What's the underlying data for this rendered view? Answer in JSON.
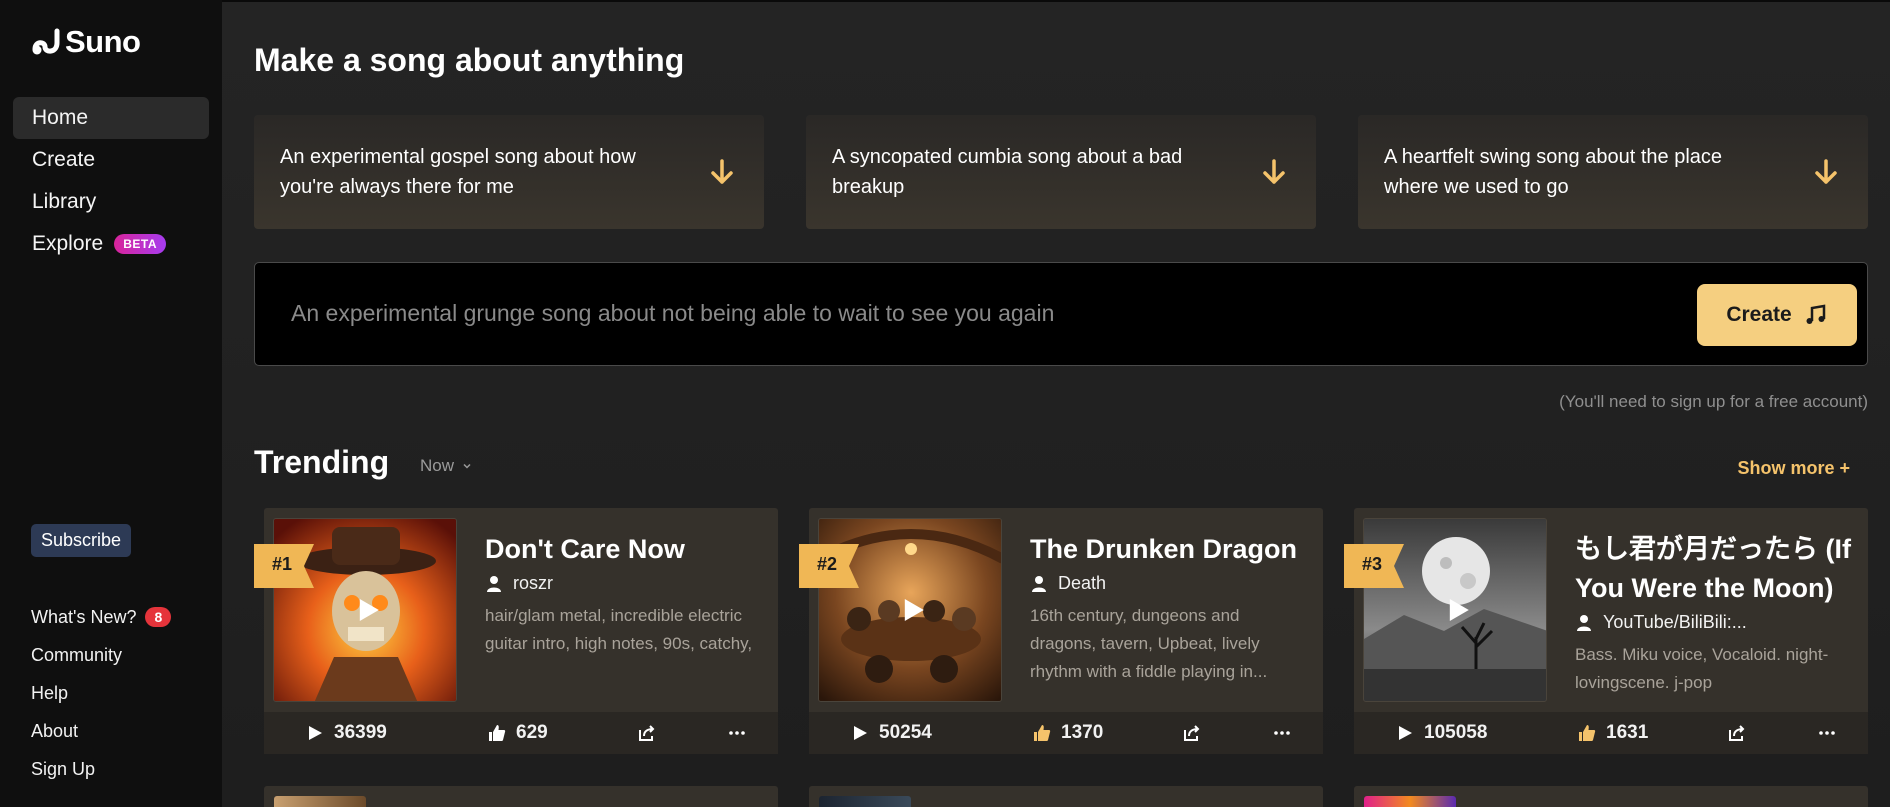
{
  "sidebar": {
    "logo_text": "Suno",
    "nav": [
      {
        "label": "Home"
      },
      {
        "label": "Create"
      },
      {
        "label": "Library"
      },
      {
        "label": "Explore",
        "badge": "BETA"
      }
    ],
    "subscribe_label": "Subscribe",
    "links": [
      {
        "label": "What's New?",
        "badge": "8"
      },
      {
        "label": "Community"
      },
      {
        "label": "Help"
      },
      {
        "label": "About"
      },
      {
        "label": "Sign Up"
      }
    ]
  },
  "main": {
    "headline": "Make a song about anything",
    "prompts": [
      {
        "text": "An experimental gospel song about how you're always there for me",
        "icon": "arrow-down-icon"
      },
      {
        "text": "A syncopated cumbia song about a bad breakup",
        "icon": "arrow-down-icon"
      },
      {
        "text": "A heartfelt swing song about the place where we used to go",
        "icon": "arrow-down-icon"
      }
    ],
    "input_placeholder": "An experimental grunge song about not being able to wait to see you again",
    "create_label": "Create",
    "signup_note": "(You'll need to sign up for a free account)",
    "trending_title": "Trending",
    "filter_label": "Now",
    "show_more_label": "Show more +"
  },
  "songs": [
    {
      "rank": "#1",
      "title": "Don't Care Now",
      "author": "roszr",
      "tags": "hair/glam metal, incredible electric guitar intro, high notes, 90s, catchy,",
      "plays": "36399",
      "likes": "629"
    },
    {
      "rank": "#2",
      "title": "The Drunken Dragon",
      "author": "Death",
      "tags": "16th century, dungeons and dragons, tavern, Upbeat, lively rhythm with a fiddle playing in...",
      "plays": "50254",
      "likes": "1370"
    },
    {
      "rank": "#3",
      "title": "もし君が月だったら (If You Were the Moon)",
      "author": "YouTube/BiliBili:...",
      "tags": "Bass. Miku voice, Vocaloid. night-lovingscene. j-pop",
      "plays": "105058",
      "likes": "1631"
    }
  ],
  "colors": {
    "accent": "#f5cf80",
    "show_more": "#f5c36b",
    "badge_red": "#e5343b",
    "beta_gradient": "#d8249a"
  }
}
